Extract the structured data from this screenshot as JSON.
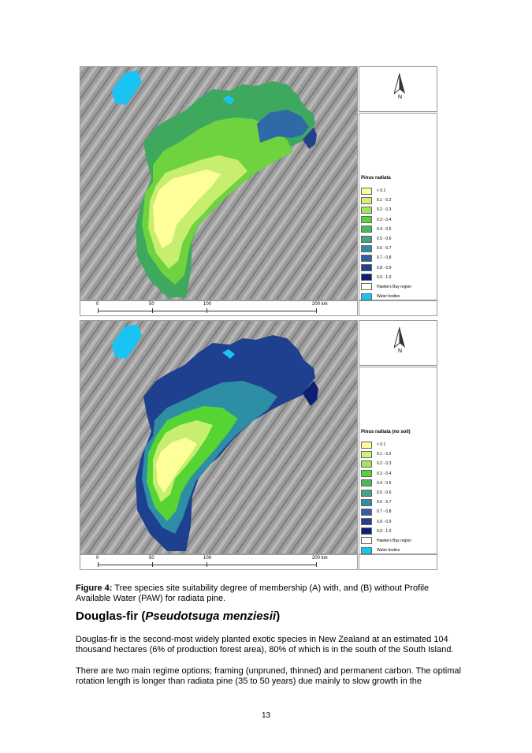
{
  "maps": [
    {
      "legend_title": "Pinus radiata",
      "variant": "with-soil",
      "legend_items": [
        "< 0.1",
        "0.1 - 0.2",
        "0.2 - 0.3",
        "0.3 - 0.4",
        "0.4 - 0.5",
        "0.5 - 0.6",
        "0.6 - 0.7",
        "0.7 - 0.8",
        "0.8 - 0.9",
        "0.9 - 1.0",
        "Hawke's Bay region",
        "Water bodies"
      ],
      "north_label": "N",
      "scale_labels": [
        "0",
        "50",
        "100",
        "200 km"
      ]
    },
    {
      "legend_title": "Pinus radiata (no soil)",
      "variant": "no-soil",
      "legend_items": [
        "< 0.1",
        "0.1 - 0.2",
        "0.2 - 0.3",
        "0.3 - 0.4",
        "0.4 - 0.5",
        "0.5 - 0.6",
        "0.6 - 0.7",
        "0.7 - 0.8",
        "0.8 - 0.9",
        "0.9 - 1.0",
        "Hawke's Bay region",
        "Water bodies"
      ],
      "north_label": "N",
      "scale_labels": [
        "0",
        "50",
        "100",
        "200 km"
      ]
    }
  ],
  "legend_colors": [
    "#ffff99",
    "#d4f07a",
    "#9fe65a",
    "#55d433",
    "#48b85c",
    "#3fa68a",
    "#2e8ea6",
    "#2f5fa6",
    "#23408f",
    "#0c1f72",
    "#ffffff",
    "#19c3f2"
  ],
  "caption": {
    "label": "Figure 4:",
    "text": " Tree species site suitability degree of membership (A) with, and (B) without Profile Available Water (PAW) for radiata pine."
  },
  "heading": {
    "prefix": "Douglas-fir (",
    "italic": "Pseudotsuga menziesii",
    "suffix": ")"
  },
  "paragraphs": [
    "Douglas-fir is the second-most widely planted exotic species in New Zealand at an estimated 104 thousand hectares (6% of production forest area), 80% of which is in the south of the South Island.",
    "There are two main regime options; framing (unpruned, thinned) and permanent carbon. The optimal rotation length is longer than radiata pine (35 to 50 years) due mainly to slow growth in the"
  ],
  "page_number": "13"
}
